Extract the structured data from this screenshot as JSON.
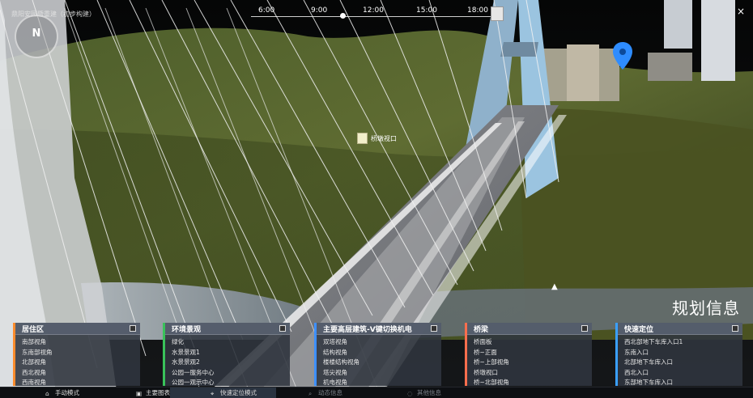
{
  "top": {
    "title": "鼎阳安园暨重建（初步构建）",
    "compass": "N",
    "timeline_ticks": [
      "6:00",
      "9:00",
      "12:00",
      "15:00",
      "18:00"
    ],
    "close_icon": "close-icon"
  },
  "viewport": {
    "tooltip": "桥墩视口",
    "section_title": "规划信息",
    "map_marker": "map-pin-icon"
  },
  "panels": [
    {
      "title": "居住区",
      "color": "#ff8c2d",
      "items": [
        "南部视角",
        "东南部视角",
        "北部视角",
        "西北视角",
        "西南视角"
      ]
    },
    {
      "title": "环境景观",
      "color": "#39c25a",
      "items": [
        "绿化",
        "水景景观1",
        "水景景观2",
        "公园一服务中心",
        "公园一观示中心"
      ]
    },
    {
      "title": "主要高层建筑-V键切换机电",
      "color": "#3e90ff",
      "items": [
        "双塔视角",
        "结构视角",
        "楼楼结构视角",
        "塔尖视角",
        "机电视角"
      ]
    },
    {
      "title": "桥梁",
      "color": "#ff6e4d",
      "items": [
        "桥面板",
        "桥~正面",
        "桥~上部视角",
        "桥墩视口",
        "桥~北部视角"
      ]
    },
    {
      "title": "快速定位",
      "color": "#3aa0ff",
      "items": [
        "西北部地下车库入口1",
        "东南入口",
        "北部地下车库入口",
        "西北入口",
        "东部地下车库入口"
      ]
    }
  ],
  "bottom_bar": [
    {
      "label": "手动模式",
      "icon": "home-icon",
      "dim": false
    },
    {
      "label": "主要图表",
      "icon": "image-icon",
      "dim": false
    },
    {
      "label": "快速定位模式",
      "icon": "location-icon",
      "dim": false
    },
    {
      "label": "动态信息",
      "icon": "search-icon",
      "dim": true
    },
    {
      "label": "其他信息",
      "icon": "globe-icon",
      "dim": true
    }
  ]
}
